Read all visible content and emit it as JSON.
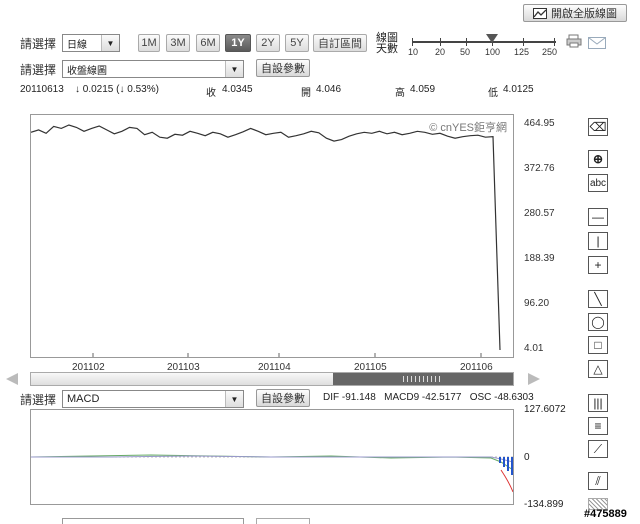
{
  "top": {
    "fullscreen_label": "開啟全版線圖"
  },
  "controls": {
    "select_label_1": "請選擇",
    "period_value": "日線",
    "ranges": [
      "1M",
      "3M",
      "6M",
      "1Y",
      "2Y",
      "5Y"
    ],
    "active_range": "1Y",
    "custom_range_label": "自訂區間",
    "linecount_label": "線圖天數",
    "slider_ticks": [
      "10",
      "20",
      "50",
      "100",
      "125",
      "250"
    ],
    "select_label_2": "請選擇",
    "chart_type_value": "收盤線圖",
    "custom_param_label": "自設參數"
  },
  "quote": {
    "date": "20110613",
    "change": "↓ 0.0215 (↓ 0.53%)",
    "close_label": "收",
    "close_value": "4.0345",
    "open_label": "開",
    "open_value": "4.046",
    "high_label": "高",
    "high_value": "4.059",
    "low_label": "低",
    "low_value": "4.0125"
  },
  "watermark": "© cnYES鉅亨網",
  "main_chart": {
    "y_ticks": [
      "464.95",
      "372.76",
      "280.57",
      "188.39",
      "96.20",
      "4.01"
    ],
    "x_ticks": [
      "201102",
      "201103",
      "201104",
      "201105",
      "201106"
    ]
  },
  "indicator": {
    "select_label": "請選擇",
    "indicator_value": "MACD",
    "custom_param_label": "自設參數",
    "readout": "DIF -91.148   MACD9 -42.5177   OSC -48.6303",
    "y_ticks": [
      "127.6072",
      "0",
      "-134.899"
    ]
  },
  "corner_id": "#475889",
  "chart_data": {
    "type": "line",
    "series": [
      {
        "values": [
          450,
          455,
          448,
          462,
          458,
          465,
          460,
          452,
          458,
          463,
          455,
          447,
          452,
          460,
          458,
          445,
          450,
          440,
          438,
          446,
          444,
          452,
          448,
          443,
          450,
          447,
          440,
          445,
          451,
          458,
          452,
          445,
          448,
          450,
          440,
          443,
          447,
          452,
          449,
          438,
          432,
          435,
          442,
          447,
          450,
          448,
          452,
          447,
          450,
          445,
          448,
          452,
          450,
          446,
          448,
          442,
          438,
          441,
          443,
          444,
          440,
          441,
          4.03
        ]
      }
    ],
    "ylim": [
      4.01,
      464.95
    ]
  }
}
